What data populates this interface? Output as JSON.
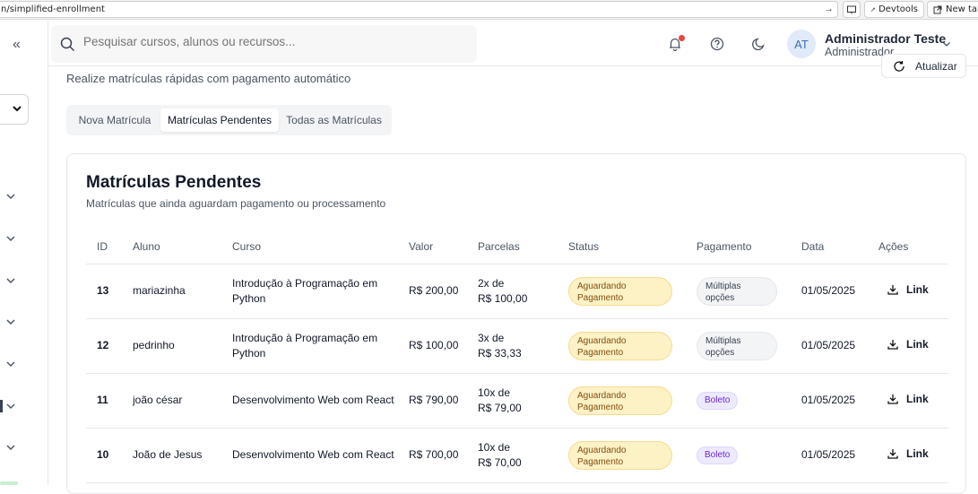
{
  "browser": {
    "url": "n/simplified-enrollment",
    "go_icon": "→",
    "devtools_label": "Devtools",
    "new_tab_label": "New tab"
  },
  "sidebar": {
    "collapse_icon": "«"
  },
  "header": {
    "search_placeholder": "Pesquisar cursos, alunos ou recursos...",
    "user_initials": "AT",
    "user_name": "Administrador Teste",
    "user_role": "Administrador"
  },
  "page": {
    "subtitle": "Realize matrículas rápidas com pagamento automático",
    "refresh_label": "Atualizar"
  },
  "tabs": [
    {
      "label": "Nova Matrícula",
      "active": false
    },
    {
      "label": "Matrículas Pendentes",
      "active": true
    },
    {
      "label": "Todas as Matrículas",
      "active": false
    }
  ],
  "card": {
    "title": "Matrículas Pendentes",
    "subtitle": "Matrículas que ainda aguardam pagamento ou processamento"
  },
  "table": {
    "headers": [
      "ID",
      "Aluno",
      "Curso",
      "Valor",
      "Parcelas",
      "Status",
      "Pagamento",
      "Data",
      "Ações"
    ],
    "rows": [
      {
        "id": "13",
        "aluno": "mariazinha",
        "curso": "Introdução à Programação em Python",
        "valor": "R$ 200,00",
        "parcelas_count": "2x de",
        "parcelas_value": "R$ 100,00",
        "status": "Aguardando Pagamento",
        "pagamento": "Múltiplas opções",
        "pagamento_type": "multi",
        "data": "01/05/2025",
        "acao": "Link"
      },
      {
        "id": "12",
        "aluno": "pedrinho",
        "curso": "Introdução à Programação em Python",
        "valor": "R$ 100,00",
        "parcelas_count": "3x de",
        "parcelas_value": "R$ 33,33",
        "status": "Aguardando Pagamento",
        "pagamento": "Múltiplas opções",
        "pagamento_type": "multi",
        "data": "01/05/2025",
        "acao": "Link"
      },
      {
        "id": "11",
        "aluno": "joão césar",
        "curso": "Desenvolvimento Web com React",
        "valor": "R$ 790,00",
        "parcelas_count": "10x de",
        "parcelas_value": "R$ 79,00",
        "status": "Aguardando Pagamento",
        "pagamento": "Boleto",
        "pagamento_type": "boleto",
        "data": "01/05/2025",
        "acao": "Link"
      },
      {
        "id": "10",
        "aluno": "João de Jesus",
        "curso": "Desenvolvimento Web com React",
        "valor": "R$ 700,00",
        "parcelas_count": "10x de",
        "parcelas_value": "R$ 70,00",
        "status": "Aguardando Pagamento",
        "pagamento": "Boleto",
        "pagamento_type": "boleto",
        "data": "01/05/2025",
        "acao": "Link"
      }
    ]
  },
  "colors": {
    "status_bg": "#fdf1c6",
    "status_text": "#854d0e",
    "boleto_bg": "#ede9fe",
    "boleto_text": "#6d28d9",
    "notification_dot": "#ef4444",
    "avatar_bg": "#e0eaf8"
  }
}
